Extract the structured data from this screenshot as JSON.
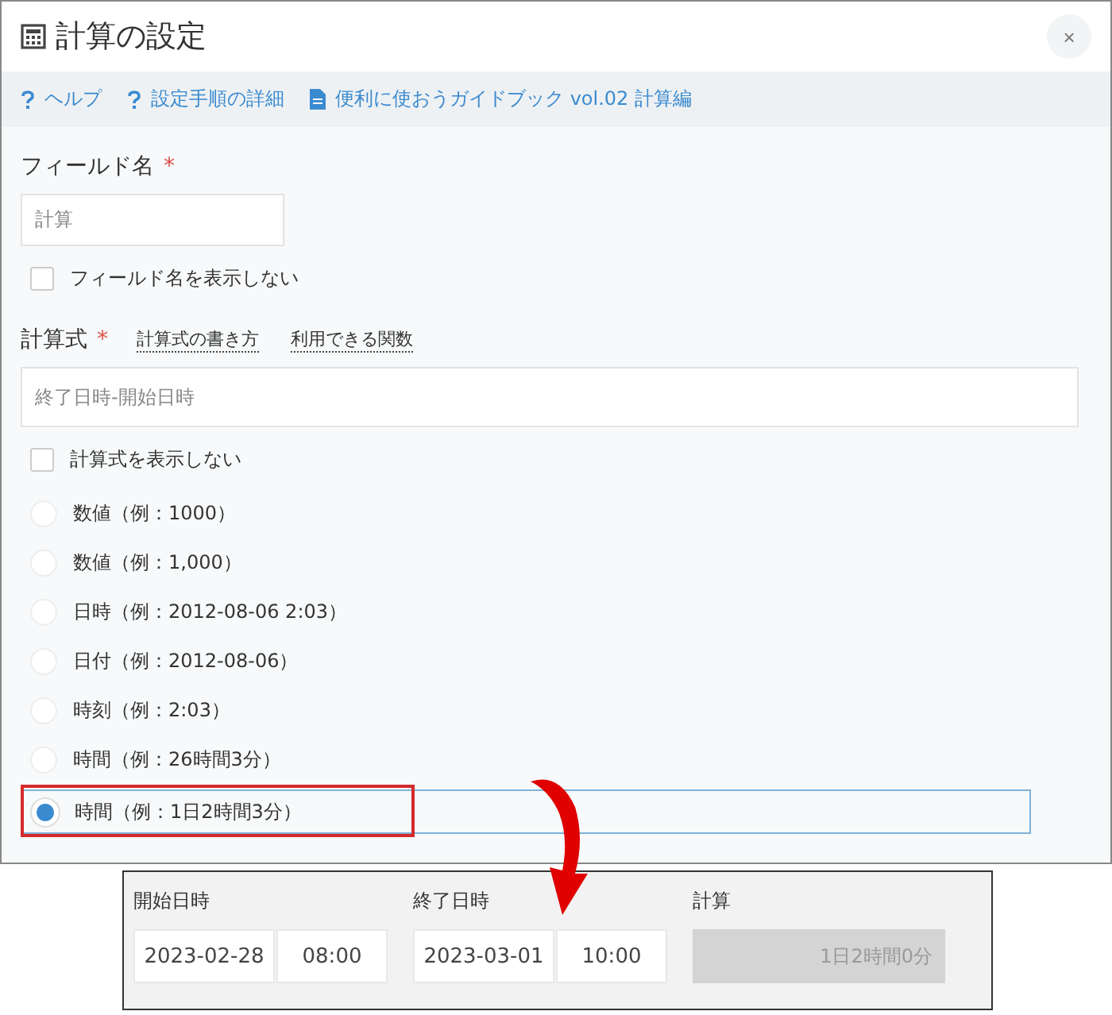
{
  "dialog": {
    "title": "計算の設定",
    "close": "×"
  },
  "links": [
    {
      "kind": "help",
      "label": "ヘルプ"
    },
    {
      "kind": "help",
      "label": "設定手順の詳細"
    },
    {
      "kind": "doc",
      "label": "便利に使おうガイドブック vol.02 計算編"
    }
  ],
  "field_name": {
    "label": "フィールド名",
    "required": "*",
    "value": "計算"
  },
  "hide_field_name": {
    "label": "フィールド名を表示しない",
    "checked": false
  },
  "formula": {
    "label": "計算式",
    "required": "*",
    "links": [
      "計算式の書き方",
      "利用できる関数"
    ],
    "value": "終了日時-開始日時"
  },
  "hide_formula": {
    "label": "計算式を表示しない",
    "checked": false
  },
  "formats": [
    {
      "label": "数値（例：1000）",
      "selected": false
    },
    {
      "label": "数値（例：1,000）",
      "selected": false
    },
    {
      "label": "日時（例：2012-08-06 2:03）",
      "selected": false
    },
    {
      "label": "日付（例：2012-08-06）",
      "selected": false
    },
    {
      "label": "時刻（例：2:03）",
      "selected": false
    },
    {
      "label": "時間（例：26時間3分）",
      "selected": false
    },
    {
      "label": "時間（例：1日2時間3分）",
      "selected": true
    }
  ],
  "example": {
    "fields": [
      {
        "label": "開始日時",
        "date": "2023-02-28",
        "time": "08:00"
      },
      {
        "label": "終了日時",
        "date": "2023-03-01",
        "time": "10:00"
      }
    ],
    "result": {
      "label": "計算",
      "value": "1日2時間0分",
      "disabled": true
    }
  }
}
